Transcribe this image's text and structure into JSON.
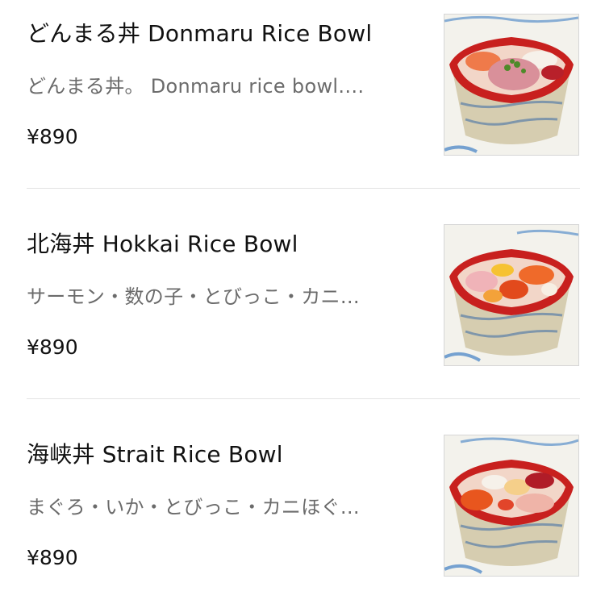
{
  "menu": {
    "items": [
      {
        "title": "どんまる丼 Donmaru Rice Bowl",
        "description": "どんまる丼。 Donmaru rice bowl.…",
        "price": "¥890",
        "image_icon": "rice-bowl-photo"
      },
      {
        "title": "北海丼 Hokkai Rice Bowl",
        "description": "サーモン・数の子・とびっこ・カニ…",
        "price": "¥890",
        "image_icon": "rice-bowl-photo"
      },
      {
        "title": "海峡丼 Strait Rice Bowl",
        "description": "まぐろ・いか・とびっこ・カニほぐ…",
        "price": "¥890",
        "image_icon": "rice-bowl-photo"
      }
    ]
  },
  "colors": {
    "title_text": "#111111",
    "description_text": "#6b6b6b",
    "divider": "#e3e3e3",
    "bowl_red": "#c8201e"
  }
}
